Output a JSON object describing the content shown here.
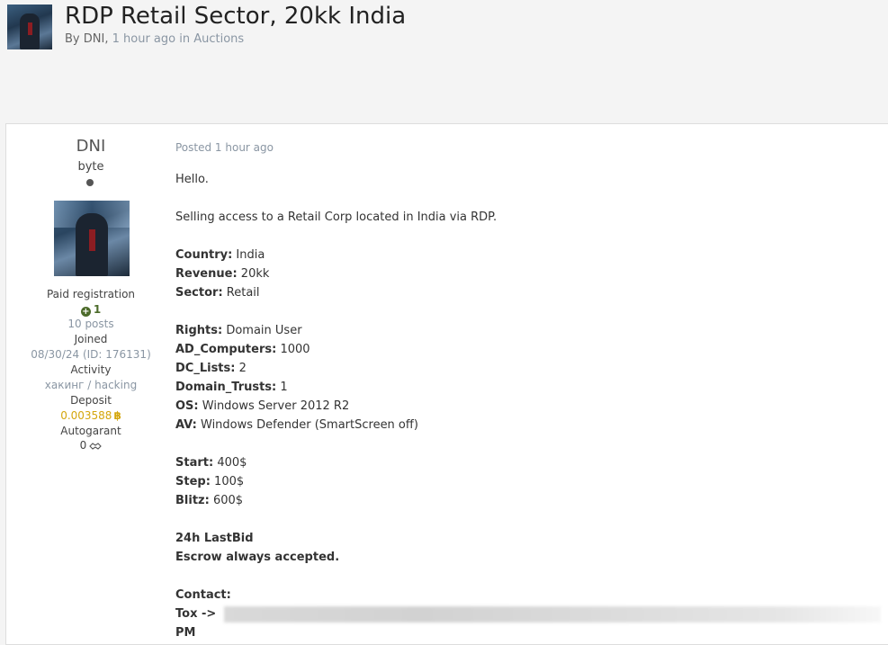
{
  "header": {
    "title": "RDP Retail Sector, 20kk India",
    "by_label": "By",
    "author": "DNI,",
    "time": "1 hour ago",
    "in_label": "in",
    "forum": "Auctions"
  },
  "author": {
    "name": "DNI",
    "rank": "byte",
    "group": "Paid registration",
    "reputation": "1",
    "posts": "10 posts",
    "joined_label": "Joined",
    "joined_value": "08/30/24 (ID: 176131)",
    "activity_label": "Activity",
    "activity_value": "хакинг / hacking",
    "deposit_label": "Deposit",
    "deposit_value": "0.003588",
    "autogarant_label": "Autogarant",
    "autogarant_value": "0"
  },
  "post": {
    "posted": "Posted 1 hour ago",
    "greeting": "Hello.",
    "intro": "Selling access to a Retail Corp located in India via RDP.",
    "fields": {
      "country": {
        "label": "Country:",
        "value": "India"
      },
      "revenue": {
        "label": "Revenue:",
        "value": "20kk"
      },
      "sector": {
        "label": "Sector:",
        "value": "Retail"
      },
      "rights": {
        "label": "Rights:",
        "value": "Domain User"
      },
      "ad_computers": {
        "label": "AD_Computers:",
        "value": "1000"
      },
      "dc_lists": {
        "label": "DC_Lists:",
        "value": "2"
      },
      "domain_trusts": {
        "label": "Domain_Trusts:",
        "value": "1"
      },
      "os": {
        "label": "OS:",
        "value": "Windows Server 2012 R2"
      },
      "av": {
        "label": "AV:",
        "value": "Windows Defender (SmartScreen off)"
      },
      "start": {
        "label": "Start:",
        "value": "400$"
      },
      "step": {
        "label": "Step:",
        "value": "100$"
      },
      "blitz": {
        "label": "Blitz:",
        "value": "600$"
      }
    },
    "lastbid": "24h LastBid",
    "escrow": "Escrow always accepted.",
    "contact_label": "Contact:",
    "tox_label": "Tox ->",
    "pm_label": "PM"
  },
  "colors": {
    "background": "#f4f4f4",
    "link_muted": "#8a96a3",
    "reputation_green": "#4c6b2a",
    "deposit_gold": "#d4a60c"
  },
  "icons": {
    "reputation": "plus-circle-icon",
    "deposit": "bitcoin-icon",
    "autogarant": "handshake-icon"
  }
}
